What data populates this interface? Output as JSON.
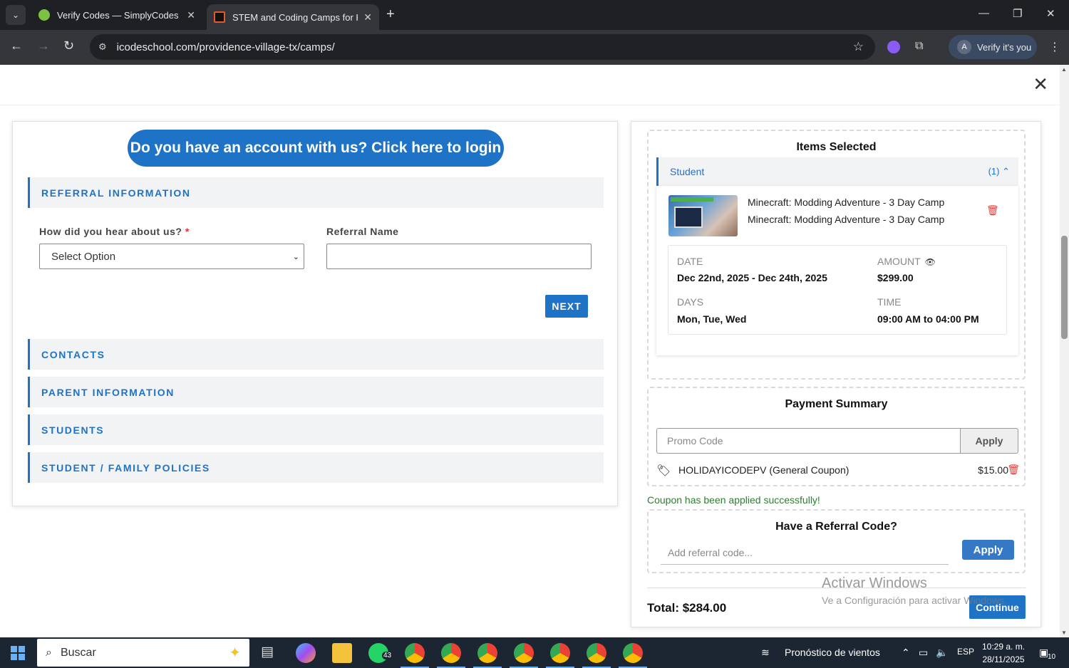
{
  "browser": {
    "tabs": [
      {
        "title": "Verify Codes — SimplyCodes",
        "active": false
      },
      {
        "title": "STEM and Coding Camps for Ki",
        "active": true
      }
    ],
    "url": "icodeschool.com/providence-village-tx/camps/",
    "profile_initial": "A",
    "verify_label": "Verify it's you"
  },
  "left": {
    "login_button": "Do you have an account with us? Click here to login",
    "referral_section": "REFERRAL INFORMATION",
    "hear_label": "How did you hear about us?",
    "required_mark": "*",
    "hear_select_value": "Select Option",
    "referral_name_label": "Referral Name",
    "referral_name_value": "",
    "next_button": "NEXT",
    "sections": [
      "CONTACTS",
      "PARENT INFORMATION",
      "STUDENTS",
      "STUDENT / FAMILY POLICIES"
    ]
  },
  "cart": {
    "title": "Items Selected",
    "student_label": "Student",
    "student_count": "(1)",
    "item_line1": "Minecraft: Modding Adventure - 3 Day Camp",
    "item_line2": "Minecraft: Modding Adventure - 3 Day Camp",
    "date_label": "DATE",
    "date_value": "Dec 22nd, 2025 - Dec 24th, 2025",
    "amount_label": "AMOUNT",
    "amount_value": "$299.00",
    "days_label": "DAYS",
    "days_value": "Mon, Tue, Wed",
    "time_label": "TIME",
    "time_value": "09:00 AM to 04:00 PM"
  },
  "payment": {
    "title": "Payment Summary",
    "promo_placeholder": "Promo Code",
    "apply_label": "Apply",
    "coupon_name": "HOLIDAYICODEPV (General Coupon)",
    "coupon_amount": "$15.00",
    "coupon_message": "Coupon has been applied successfully!"
  },
  "referral": {
    "title": "Have a Referral Code?",
    "placeholder": "Add referral code...",
    "apply_label": "Apply"
  },
  "total": "Total: $284.00",
  "continue_label": "Continue",
  "watermark": {
    "line1": "Activar Windows",
    "line2": "Ve a Configuración para activar Windows."
  },
  "taskbar": {
    "search_label": "Buscar",
    "whatsapp_badge": "43",
    "weather": "Pronóstico de vientos",
    "language": "ESP",
    "time": "10:29 a. m.",
    "date": "28/11/2025",
    "notifications": "10"
  },
  "colors": {
    "accent": "#1f73c7",
    "danger": "#e53935",
    "success": "#2e7d32"
  }
}
